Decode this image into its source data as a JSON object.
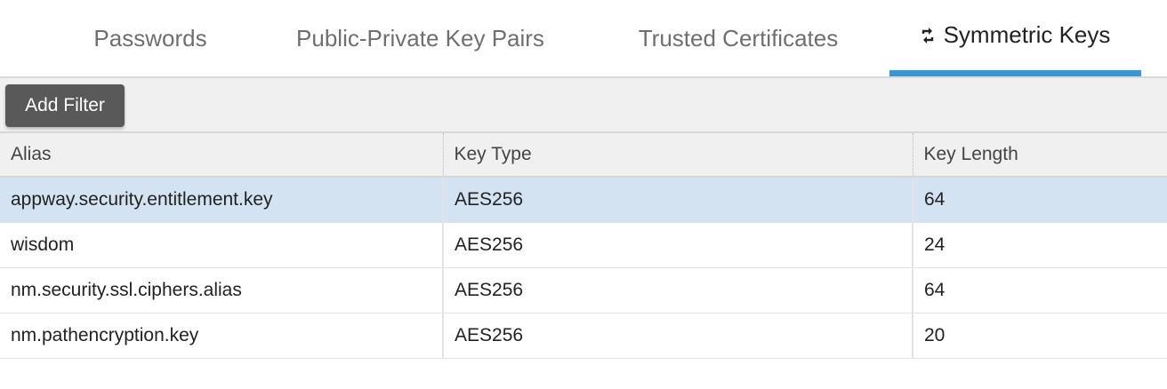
{
  "tabs": [
    {
      "label": "Passwords",
      "active": false
    },
    {
      "label": "Public-Private Key Pairs",
      "active": false
    },
    {
      "label": "Trusted Certificates",
      "active": false
    },
    {
      "label": "Symmetric Keys",
      "active": true,
      "icon": "refresh-arrows-icon"
    }
  ],
  "toolbar": {
    "add_filter_label": "Add Filter"
  },
  "table": {
    "columns": [
      "Alias",
      "Key Type",
      "Key Length"
    ],
    "rows": [
      {
        "alias": "appway.security.entitlement.key",
        "key_type": "AES256",
        "key_length": "64",
        "selected": true
      },
      {
        "alias": "wisdom",
        "key_type": "AES256",
        "key_length": "24",
        "selected": false
      },
      {
        "alias": "nm.security.ssl.ciphers.alias",
        "key_type": "AES256",
        "key_length": "64",
        "selected": false
      },
      {
        "alias": "nm.pathencryption.key",
        "key_type": "AES256",
        "key_length": "20",
        "selected": false
      }
    ]
  },
  "colors": {
    "active_tab_underline": "#3a95d6",
    "selected_row": "#d4e3f1",
    "button_bg": "#595959"
  }
}
